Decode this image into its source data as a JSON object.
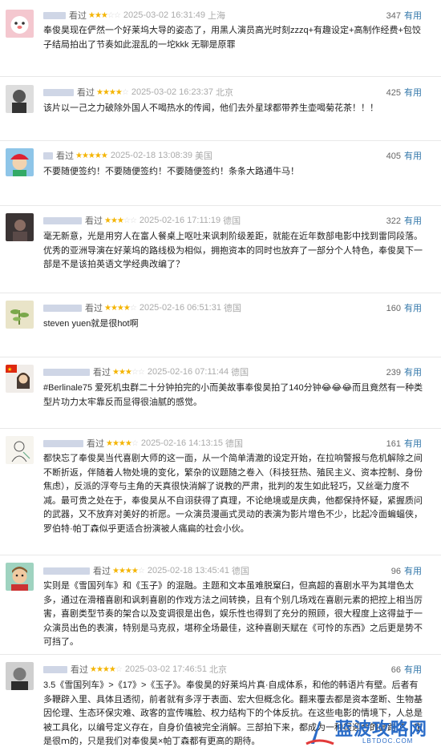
{
  "reviews": [
    {
      "watched": "看过",
      "rating": 3,
      "stars_on": "★★★",
      "stars_off": "☆☆",
      "time": "2025-03-02 16:31:49",
      "location": "上海",
      "votes": "347",
      "useful": "有用",
      "text": "奉俊昊现在俨然一个好莱坞大导的姿态了，用黑人演员高光时刻zzzq+有趣设定+高制作经费+包饺子结局拍出了节奏如此混乱的一坨kkk 无聊是原罪",
      "avatar": "pink-cartoon"
    },
    {
      "watched": "看过",
      "rating": 4,
      "stars_on": "★★★★",
      "stars_off": "☆",
      "time": "2025-03-02 16:23:37",
      "location": "北京",
      "votes": "425",
      "useful": "有用",
      "text": "该片以一己之力破除外国人不喝热水的传闻，他们去外星球都带养生壶喝菊花茶！！！",
      "avatar": "bw-portrait"
    },
    {
      "watched": "看过",
      "rating": 5,
      "stars_on": "★★★★★",
      "stars_off": "",
      "time": "2025-02-18 13:08:39",
      "location": "美国",
      "votes": "405",
      "useful": "有用",
      "text": "不要随便签约！不要随便签约！不要随便签约！条条大路通牛马！",
      "avatar": "anime-boy"
    },
    {
      "watched": "看过",
      "rating": 3,
      "stars_on": "★★★",
      "stars_off": "☆☆",
      "time": "2025-02-16 17:11:19",
      "location": "德国",
      "votes": "322",
      "useful": "有用",
      "text": "毫无新意，光是用穷人在富人餐桌上呕吐来讽刺阶级差距，就能在近年数部电影中找到雷同段落。优秀的亚洲导演在好莱坞的路线极为相似，拥抱资本的同时也放弃了一部分个人特色，奉俊昊下一部是不是该拍英语文学经典改编了？",
      "avatar": "dark-photo"
    },
    {
      "watched": "看过",
      "rating": 4,
      "stars_on": "★★★★",
      "stars_off": "☆",
      "time": "2025-02-16 06:51:31",
      "location": "德国",
      "votes": "160",
      "useful": "有用",
      "text": "steven yuen就是很hot啊",
      "avatar": "plant"
    },
    {
      "watched": "看过",
      "rating": 3,
      "stars_on": "★★★",
      "stars_off": "☆☆",
      "time": "2025-02-16 07:11:44",
      "location": "德国",
      "votes": "239",
      "useful": "有用",
      "text": "#Berlinale75 爱死机虫群二十分钟拍完的小而美故事奉俊昊拍了140分钟😂😂😂而且竟然有一种类型片功力太牢靠反而显得很油腻的感觉。",
      "avatar": "flag-girl"
    },
    {
      "watched": "看过",
      "rating": 4,
      "stars_on": "★★★★",
      "stars_off": "☆",
      "time": "2025-02-16 14:13:15",
      "location": "德国",
      "votes": "161",
      "useful": "有用",
      "text": "都快忘了奉俊昊当代喜剧大师的这一面，从一个简单清澈的设定开始，在拉响警报与危机解除之间不断折返，伴随着人物处境的变化，繁杂的议题随之卷入（科技狂热、殖民主义、资本控制、身份焦虑），反派的浮夸与主角的天真很快消解了说教的严肃，批判的发生如此轻巧，又丝毫力度不减。最可贵之处在于，奉俊昊从不自诩获得了真理，不论绝境或是庆典，他都保持怀疑，紧握质问的武器，又不放弃对美好的祈愿。一众演员漫画式灵动的表演为影片增色不少，比起冷面蝙蝠侠，罗伯特·帕丁森似乎更适合扮演被人痛扁的社会小伙。",
      "avatar": "sketch"
    },
    {
      "watched": "看过",
      "rating": 4,
      "stars_on": "★★★★",
      "stars_off": "☆",
      "time": "2025-02-18 13:45:41",
      "location": "德国",
      "votes": "96",
      "useful": "有用",
      "text": "实则是《雪国列车》和《玉子》的混融。主题和文本虽难脱窠臼，但高超的喜剧水平为其增色太多，通过在滑稽喜剧和讽刺喜剧的作戏方法之间转换，且有个别几场戏在喜剧元素的把控上相当厉害，喜剧类型节奏的架合以及变调很是出色，娱乐性也得到了充分的照顾，很大程度上这得益于一众演员出色的表演，特别是马克叔，堪称全场最佳，这种喜剧天赋在《可怜的东西》之后更是势不可挡了。",
      "avatar": "cartoon-man"
    },
    {
      "watched": "看过",
      "rating": 4,
      "stars_on": "★★★★",
      "stars_off": "☆",
      "time": "2025-03-02 17:46:51",
      "location": "北京",
      "votes": "66",
      "useful": "有用",
      "text": "3.5《雪国列车》>《17》>《玉子》。奉俊昊的好莱坞片真·自成体系，和他的韩语片有壁。后者有多鞭辟入里、具体且透彻，前者就有多浮于表面、宏大但概念化。翻来覆去都是资本垄断、生物基因伦理、生态环保灾难、政客的宣传嘴脸、权力结构下的个体反抗。在这些电影的情境下，人总是被工具化，以编号定义存在，自身价值被完全消解。三部拍下来，都成为一种很迎合的套路了，定是很ｍ的，只是我们对奉俊昊×帕丁森都有更高的期待。",
      "avatar": "bw-man"
    }
  ],
  "watermark": {
    "title": "蓝波攻略网",
    "url": "LBTDOC.COM"
  }
}
